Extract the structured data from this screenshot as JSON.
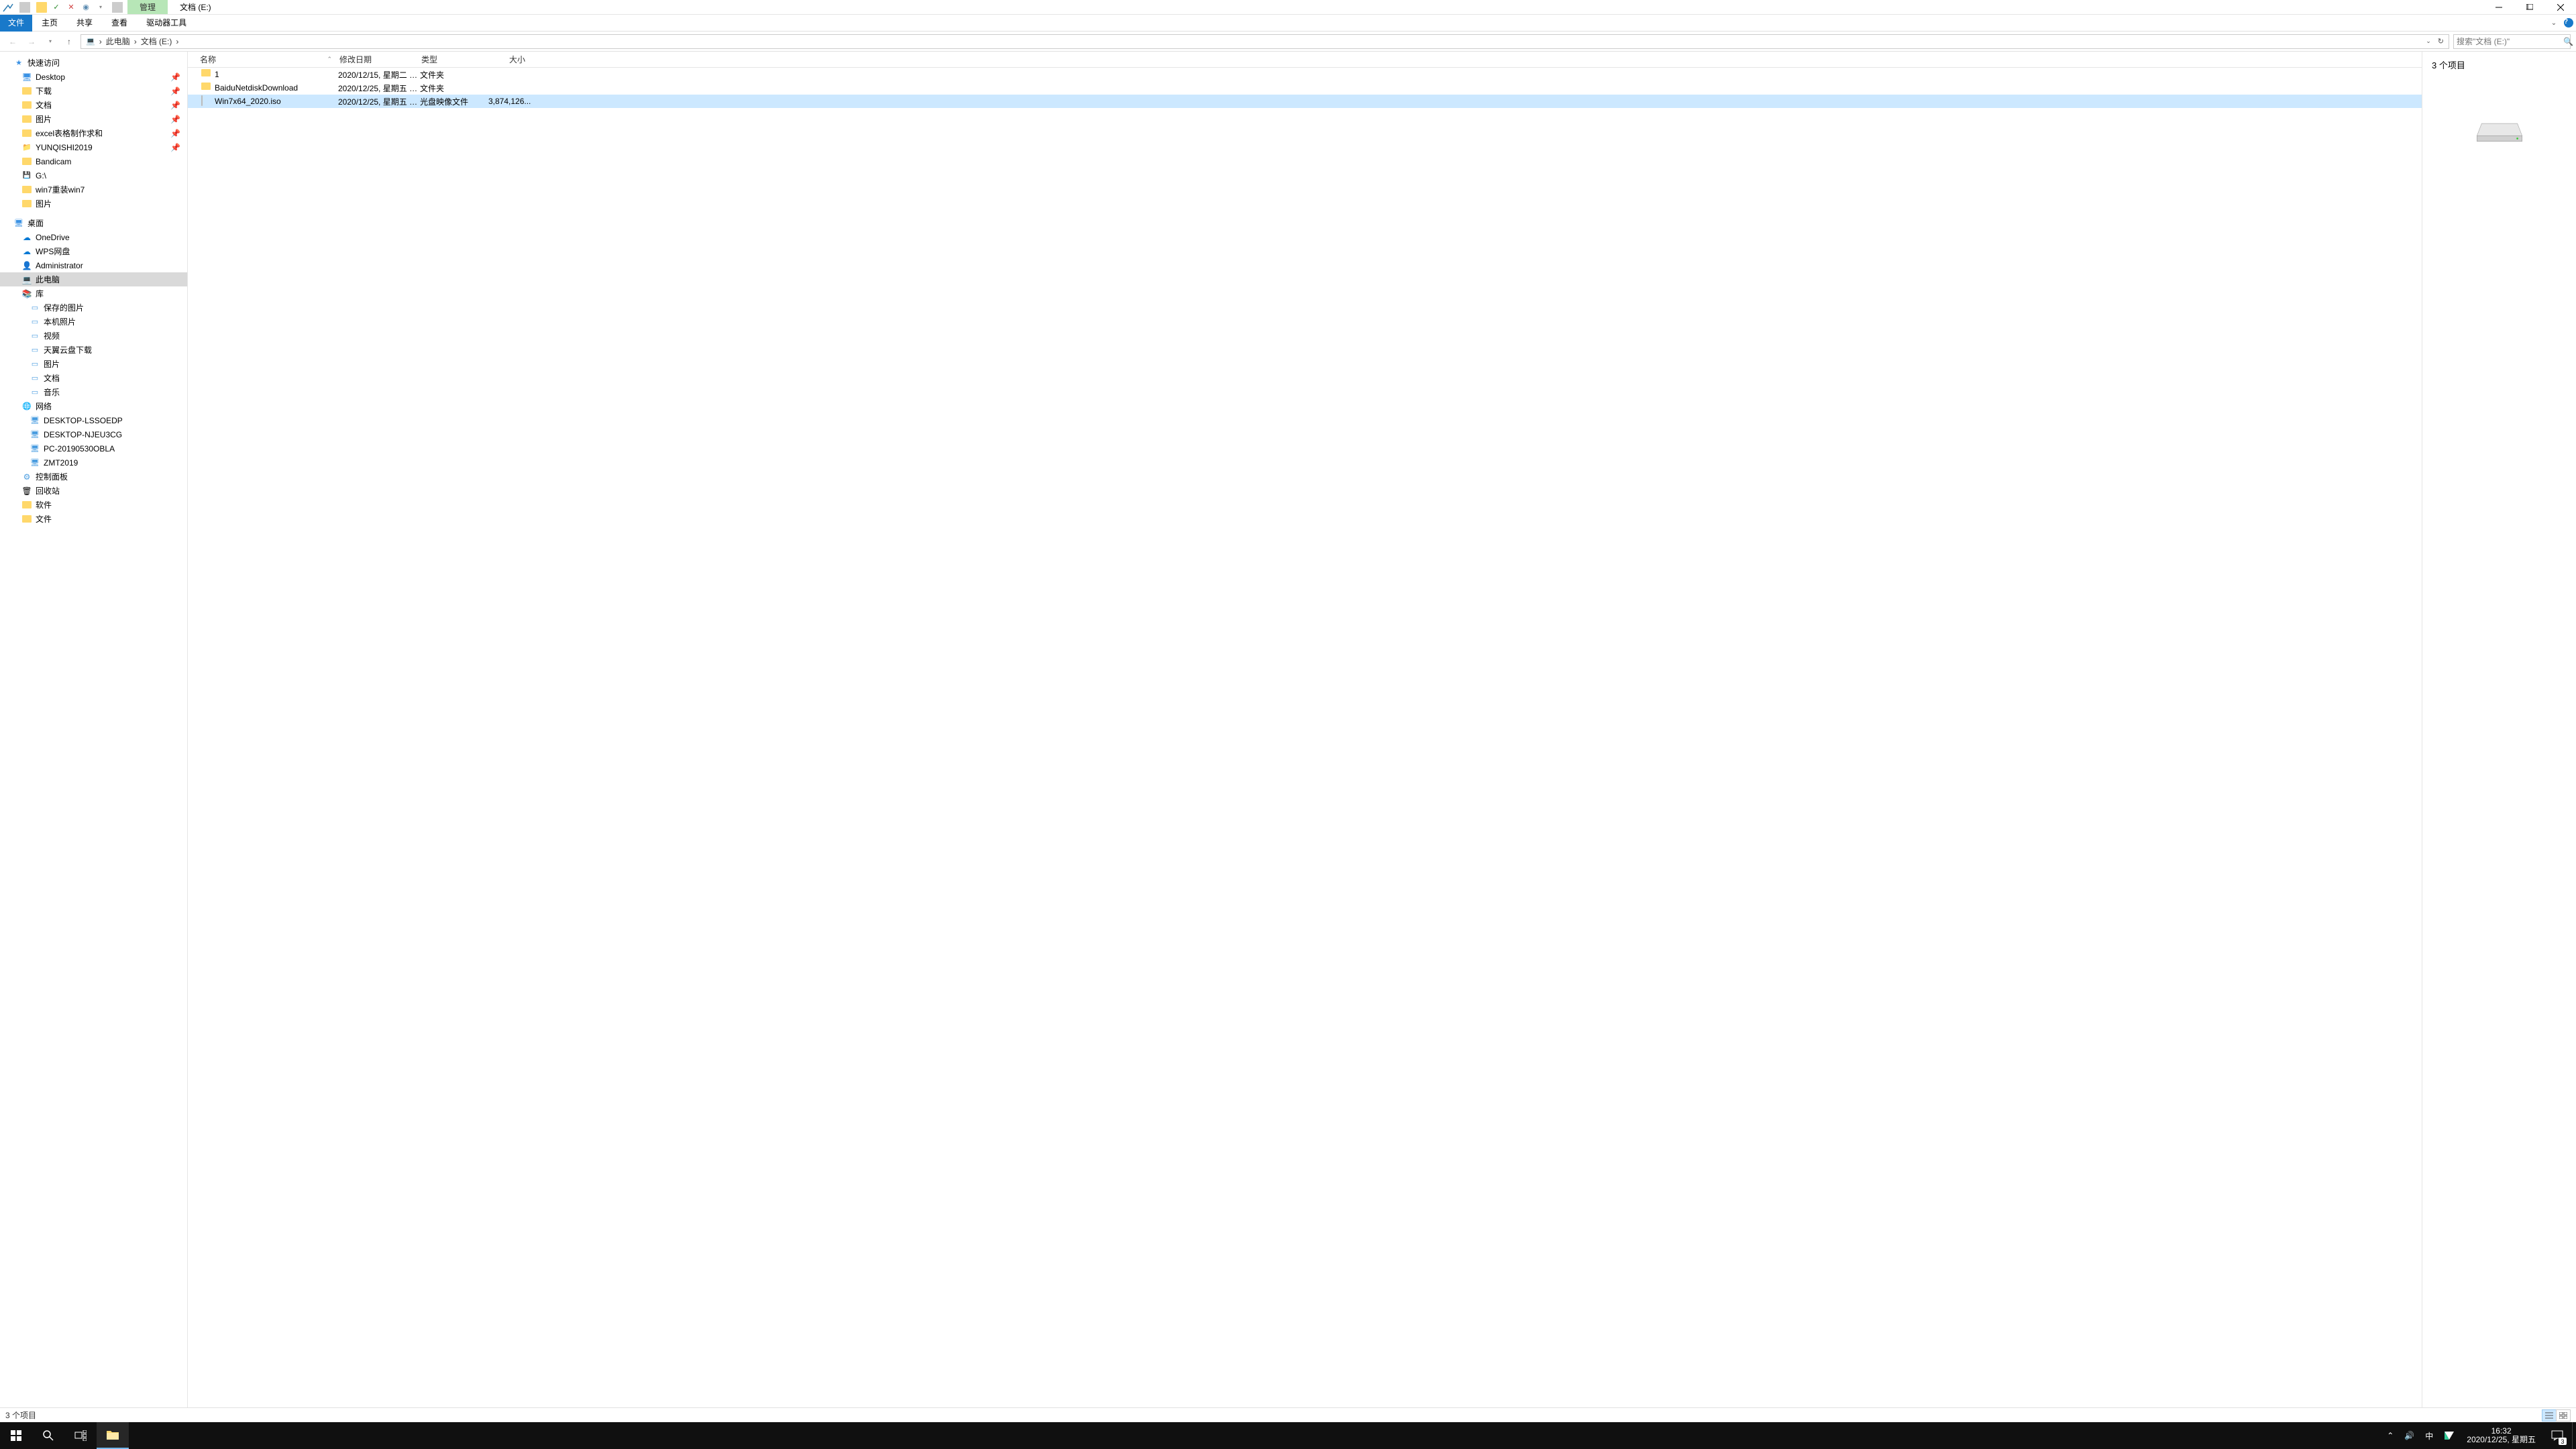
{
  "title": {
    "context_tab": "管理",
    "drive_label": "文档 (E:)"
  },
  "ribbon": {
    "file": "文件",
    "home": "主页",
    "share": "共享",
    "view": "查看",
    "drive_tools": "驱动器工具"
  },
  "nav": {
    "back": "←",
    "fwd": "→",
    "up": "↑"
  },
  "breadcrumb": {
    "items": [
      "此电脑",
      "文档 (E:)"
    ],
    "sep": "›"
  },
  "search": {
    "placeholder": "搜索\"文档 (E:)\""
  },
  "tree": {
    "quick_access": "快速访问",
    "qa_items": [
      {
        "label": "Desktop",
        "icon": "desktop"
      },
      {
        "label": "下载",
        "icon": "folder"
      },
      {
        "label": "文档",
        "icon": "folder"
      },
      {
        "label": "图片",
        "icon": "folder"
      },
      {
        "label": "excel表格制作求和",
        "icon": "folder"
      },
      {
        "label": "YUNQISHI2019",
        "icon": "folder-special"
      },
      {
        "label": "Bandicam",
        "icon": "folder"
      },
      {
        "label": "G:\\",
        "icon": "drive-g"
      },
      {
        "label": "win7重装win7",
        "icon": "folder"
      },
      {
        "label": "图片",
        "icon": "folder"
      }
    ],
    "desktop": "桌面",
    "desktop_items": [
      {
        "label": "OneDrive",
        "icon": "onedrive"
      },
      {
        "label": "WPS网盘",
        "icon": "wps"
      },
      {
        "label": "Administrator",
        "icon": "user"
      },
      {
        "label": "此电脑",
        "icon": "pc",
        "selected": true
      },
      {
        "label": "库",
        "icon": "library"
      }
    ],
    "library_items": [
      {
        "label": "保存的图片"
      },
      {
        "label": "本机照片"
      },
      {
        "label": "视频"
      },
      {
        "label": "天翼云盘下载"
      },
      {
        "label": "图片"
      },
      {
        "label": "文档"
      },
      {
        "label": "音乐"
      }
    ],
    "network": "网络",
    "network_items": [
      {
        "label": "DESKTOP-LSSOEDP"
      },
      {
        "label": "DESKTOP-NJEU3CG"
      },
      {
        "label": "PC-20190530OBLA"
      },
      {
        "label": "ZMT2019"
      }
    ],
    "extra_items": [
      {
        "label": "控制面板",
        "icon": "cpanel"
      },
      {
        "label": "回收站",
        "icon": "recycle"
      },
      {
        "label": "软件",
        "icon": "folder"
      },
      {
        "label": "文件",
        "icon": "folder"
      }
    ]
  },
  "columns": {
    "name": "名称",
    "date": "修改日期",
    "type": "类型",
    "size": "大小"
  },
  "files": [
    {
      "name": "1",
      "date": "2020/12/15, 星期二 1...",
      "type": "文件夹",
      "size": "",
      "icon": "folder"
    },
    {
      "name": "BaiduNetdiskDownload",
      "date": "2020/12/25, 星期五 1...",
      "type": "文件夹",
      "size": "",
      "icon": "folder"
    },
    {
      "name": "Win7x64_2020.iso",
      "date": "2020/12/25, 星期五 1...",
      "type": "光盘映像文件",
      "size": "3,874,126...",
      "icon": "iso",
      "selected": true
    }
  ],
  "preview": {
    "count": "3 个项目"
  },
  "status": {
    "text": "3 个项目"
  },
  "taskbar": {
    "time": "16:32",
    "date": "2020/12/25, 星期五",
    "ime": "中",
    "notif_count": "3"
  }
}
